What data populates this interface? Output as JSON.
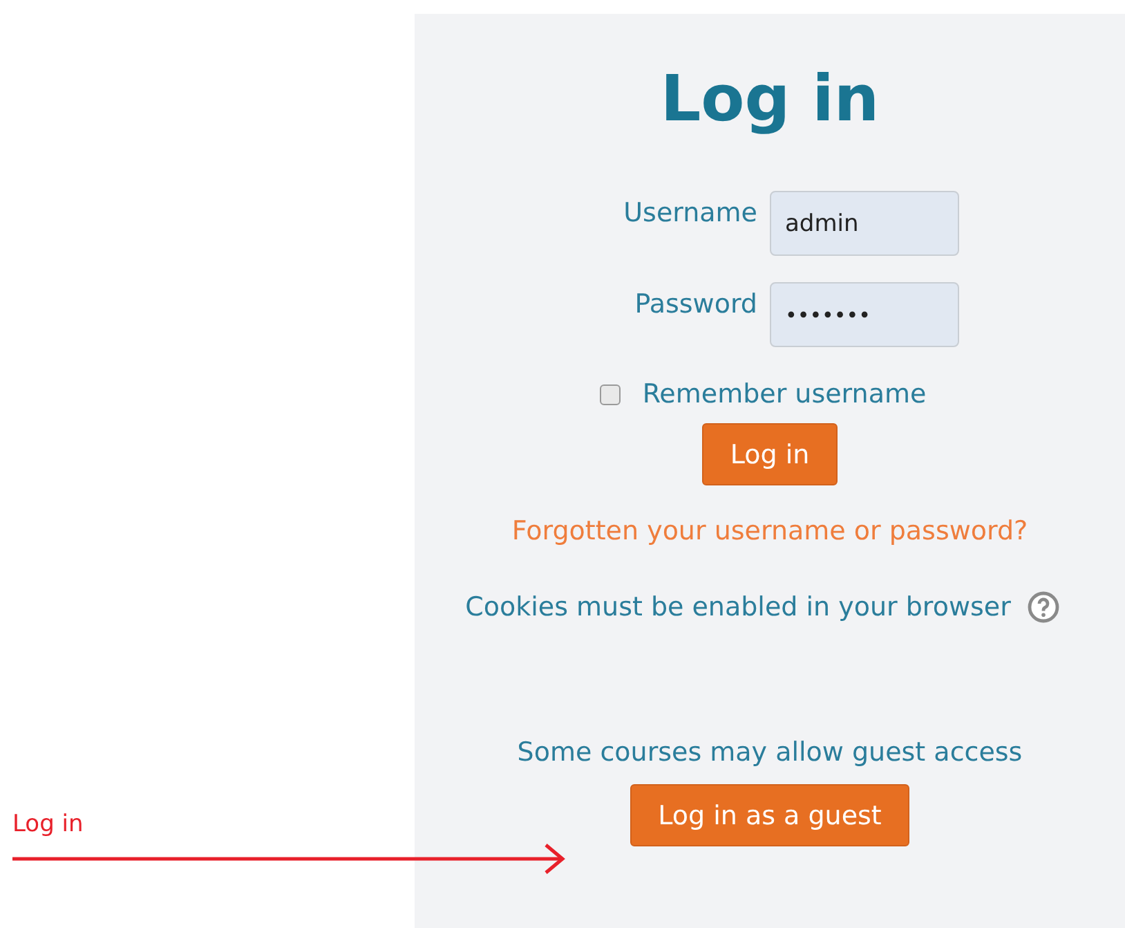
{
  "title": "Log in",
  "fields": [
    {
      "label": "Username",
      "value": "admin",
      "kind": "text"
    },
    {
      "label": "Password",
      "value": "•••••••",
      "kind": "password"
    }
  ],
  "remember": {
    "label": "Remember username",
    "checked": false
  },
  "login_button": "Log in",
  "forgot_link": "Forgotten your username or password?",
  "cookies_text": "Cookies must be enabled in your browser",
  "guest": {
    "text": "Some courses may allow guest access",
    "button": "Log in as a guest"
  },
  "annotation": {
    "label": "Log in"
  }
}
